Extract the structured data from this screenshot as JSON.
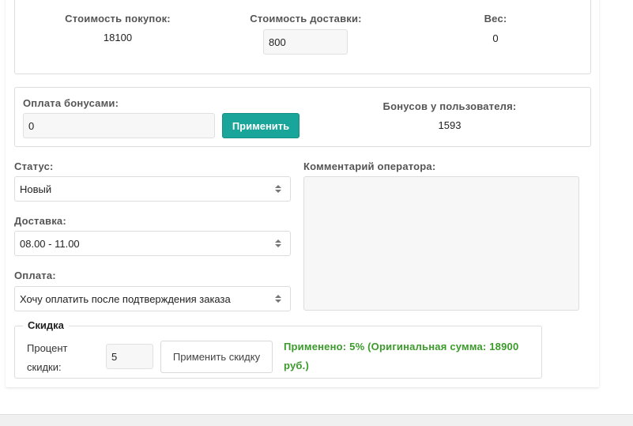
{
  "summary": {
    "purchases_label": "Стоимость покупок:",
    "purchases_value": "18100",
    "delivery_label": "Стоимость доставки:",
    "delivery_value": "800",
    "weight_label": "Вес:",
    "weight_value": "0"
  },
  "bonus": {
    "pay_label": "Оплата бонусами:",
    "pay_value": "0",
    "apply_label": "Применить",
    "user_bonus_label": "Бонусов у пользователя:",
    "user_bonus_value": "1593"
  },
  "status": {
    "label": "Статус:",
    "value": "Новый"
  },
  "delivery": {
    "label": "Доставка:",
    "value": "08.00 - 11.00"
  },
  "payment": {
    "label": "Оплата:",
    "value": "Хочу оплатить после подтверждения заказа"
  },
  "comment": {
    "label": "Комментарий оператора:",
    "value": ""
  },
  "discount": {
    "legend": "Скидка",
    "percent_label_line1": "Процент",
    "percent_label_line2": "скидки:",
    "percent_value": "5",
    "apply_label": "Применить скидку",
    "result_line1": "Применено: 5% (Оригинальная сумма: 18900",
    "result_line2": "руб.)"
  },
  "colors": {
    "accent": "#1aa59a",
    "success": "#3a9a2a"
  }
}
